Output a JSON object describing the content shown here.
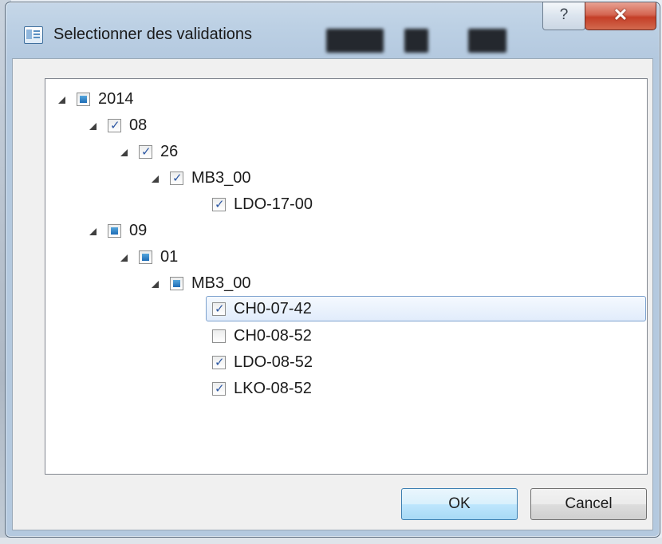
{
  "window": {
    "title": "Selectionner des validations",
    "help_label": "?",
    "close_label": "✕"
  },
  "tree": [
    {
      "label": "2014",
      "state": "partial",
      "expanded": true
    },
    {
      "label": "08",
      "state": "checked",
      "expanded": true
    },
    {
      "label": "26",
      "state": "checked",
      "expanded": true
    },
    {
      "label": "MB3_00",
      "state": "checked",
      "expanded": true
    },
    {
      "label": "LDO-17-00",
      "state": "checked"
    },
    {
      "label": "09",
      "state": "partial",
      "expanded": true
    },
    {
      "label": "01",
      "state": "partial",
      "expanded": true
    },
    {
      "label": "MB3_00",
      "state": "partial",
      "expanded": true
    },
    {
      "label": "CH0-07-42",
      "state": "checked",
      "selected": true
    },
    {
      "label": "CH0-08-52",
      "state": "unchecked"
    },
    {
      "label": "LDO-08-52",
      "state": "checked"
    },
    {
      "label": "LKO-08-52",
      "state": "checked"
    }
  ],
  "buttons": {
    "ok": "OK",
    "cancel": "Cancel"
  }
}
